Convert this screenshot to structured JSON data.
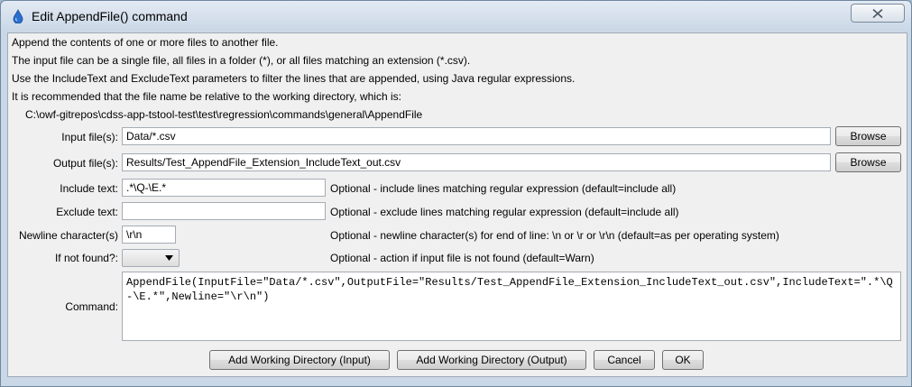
{
  "window": {
    "title": "Edit AppendFile() command",
    "close_icon": "close-icon",
    "app_icon": "water-drop-icon"
  },
  "description": [
    "Append the contents of one or more files to another file.",
    "The input file can be a single file, all files in a folder (*), or all files matching an extension (*.csv).",
    "Use the IncludeText and ExcludeText parameters to filter the lines that are appended, using Java regular expressions.",
    "It is recommended that the file name be relative to the working directory, which is:"
  ],
  "working_directory": "C:\\owf-gitrepos\\cdss-app-tstool-test\\test\\regression\\commands\\general\\AppendFile",
  "fields": {
    "input_file": {
      "label": "Input file(s):",
      "value": "Data/*.csv",
      "button": "Browse"
    },
    "output_file": {
      "label": "Output file(s):",
      "value": "Results/Test_AppendFile_Extension_IncludeText_out.csv",
      "button": "Browse"
    },
    "include_text": {
      "label": "Include text:",
      "value": ".*\\Q-\\E.*",
      "note": "Optional - include lines matching regular expression (default=include all)"
    },
    "exclude_text": {
      "label": "Exclude text:",
      "value": "",
      "note": "Optional - exclude lines matching regular expression (default=include all)"
    },
    "newline": {
      "label": "Newline character(s)",
      "value": "\\r\\n",
      "note": "Optional - newline character(s) for end of line: \\n or \\r or \\r\\n (default=as per operating system)"
    },
    "if_not_found": {
      "label": "If not found?:",
      "value": "",
      "note": "Optional - action if input file is not found (default=Warn)"
    },
    "command": {
      "label": "Command:",
      "value": "AppendFile(InputFile=\"Data/*.csv\",OutputFile=\"Results/Test_AppendFile_Extension_IncludeText_out.csv\",IncludeText=\".*\\Q-\\E.*\",Newline=\"\\r\\n\")"
    }
  },
  "buttons": {
    "add_wd_input": "Add Working Directory (Input)",
    "add_wd_output": "Add Working Directory (Output)",
    "cancel": "Cancel",
    "ok": "OK"
  }
}
